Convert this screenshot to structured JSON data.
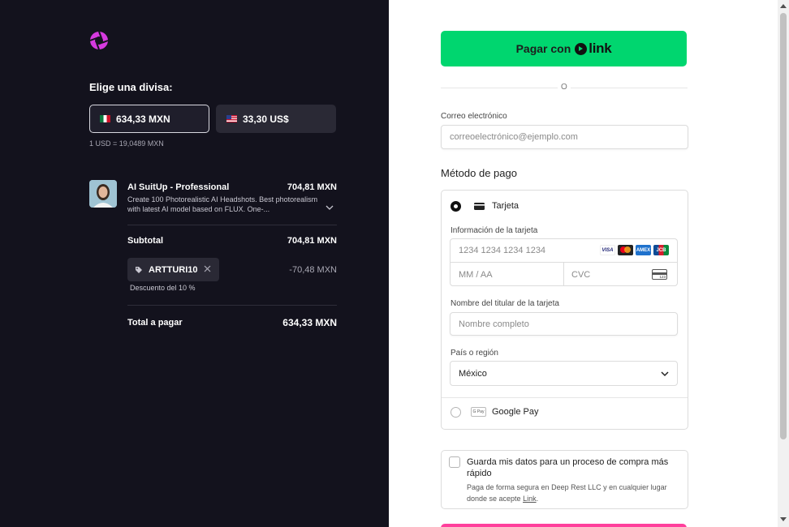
{
  "summary": {
    "currency_title": "Elige una divisa:",
    "currency_options": [
      {
        "label": "634,33 MXN",
        "selected": true
      },
      {
        "label": "33,30 US$",
        "selected": false
      }
    ],
    "exchange_rate": "1 USD = 19,0489 MXN",
    "product": {
      "name": "AI SuitUp - Professional",
      "price": "704,81 MXN",
      "description": "Create 100 Photorealistic AI Headshots. Best photorealism with latest AI model based on FLUX. One-..."
    },
    "subtotal_label": "Subtotal",
    "subtotal_value": "704,81 MXN",
    "promo_code": "ARTTURI10",
    "discount_value": "-70,48 MXN",
    "discount_label": "Descuento del 10 %",
    "total_label": "Total a pagar",
    "total_value": "634,33 MXN"
  },
  "checkout": {
    "link_button_prefix": "Pagar con",
    "link_brand": "link",
    "or_label": "O",
    "email_label": "Correo electrónico",
    "email_placeholder": "correoelectrónico@ejemplo.com",
    "payment_method_title": "Método de pago",
    "methods": [
      {
        "label": "Tarjeta",
        "selected": true
      },
      {
        "label": "Google Pay",
        "selected": false
      }
    ],
    "card_info_label": "Información de la tarjeta",
    "card_number_placeholder": "1234 1234 1234 1234",
    "card_brands": [
      "VISA",
      "mastercard",
      "AMEX",
      "JCB"
    ],
    "expiry_placeholder": "MM / AA",
    "cvc_placeholder": "CVC",
    "cardholder_label": "Nombre del titular de la tarjeta",
    "cardholder_placeholder": "Nombre completo",
    "country_label": "País o región",
    "country_value": "México",
    "gpay_icon_text": "G Pay",
    "save_title": "Guarda mis datos para un proceso de compra más rápido",
    "save_desc_prefix": "Paga de forma segura en Deep Rest LLC y en cualquier lugar donde se acepte ",
    "save_desc_link": "Link",
    "save_desc_suffix": "."
  },
  "colors": {
    "left_bg": "#13121d",
    "link_green": "#00d66f",
    "pay_button_pink": "#ff3f9c",
    "logo_magenta": "#d63adf"
  }
}
